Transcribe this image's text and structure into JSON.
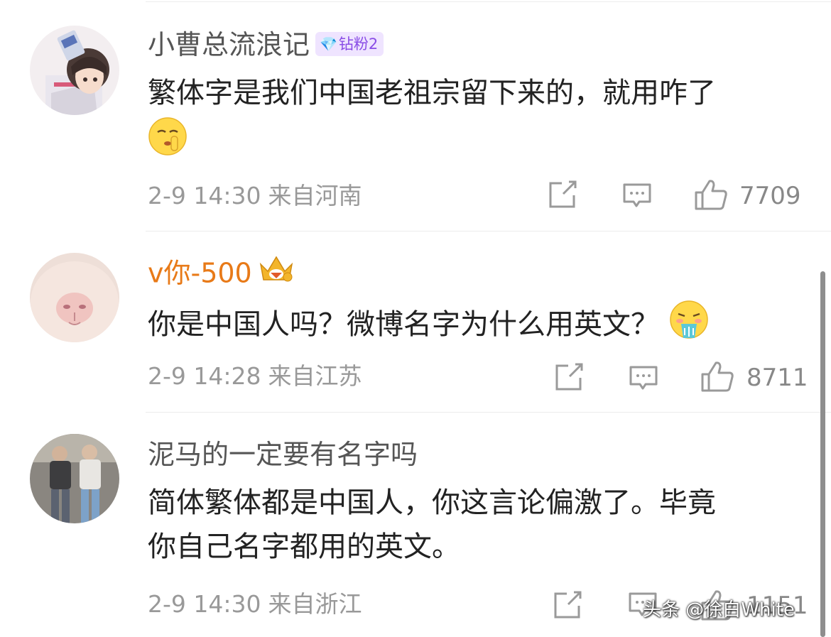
{
  "comments": [
    {
      "username": "小曹总流浪记",
      "badge": "钻粉2",
      "text": "繁体字是我们中国老祖宗留下来的，就用咋了",
      "emoji": "shush-face-emoji",
      "date": "2-9 14:30",
      "location": "来自河南",
      "likes": "7709"
    },
    {
      "username": "v你-500",
      "badge_icon": "crown-icon",
      "text": "你是中国人吗？微博名字为什么用英文？",
      "emoji": "vomit-face-emoji",
      "date": "2-9 14:28",
      "location": "来自江苏",
      "likes": "8711"
    },
    {
      "username": "泥马的一定要有名字吗",
      "text_line1": "简体繁体都是中国人，你这言论偏激了。毕竟",
      "text_line2": "你自己名字都用的英文。",
      "date": "2-9 14:30",
      "location": "来自浙江",
      "likes": "1151"
    }
  ],
  "watermark": "头条 @徐白White",
  "colors": {
    "vip_name": "#e87a18",
    "badge_bg": "#efe4ff",
    "badge_text": "#8a4de6"
  }
}
